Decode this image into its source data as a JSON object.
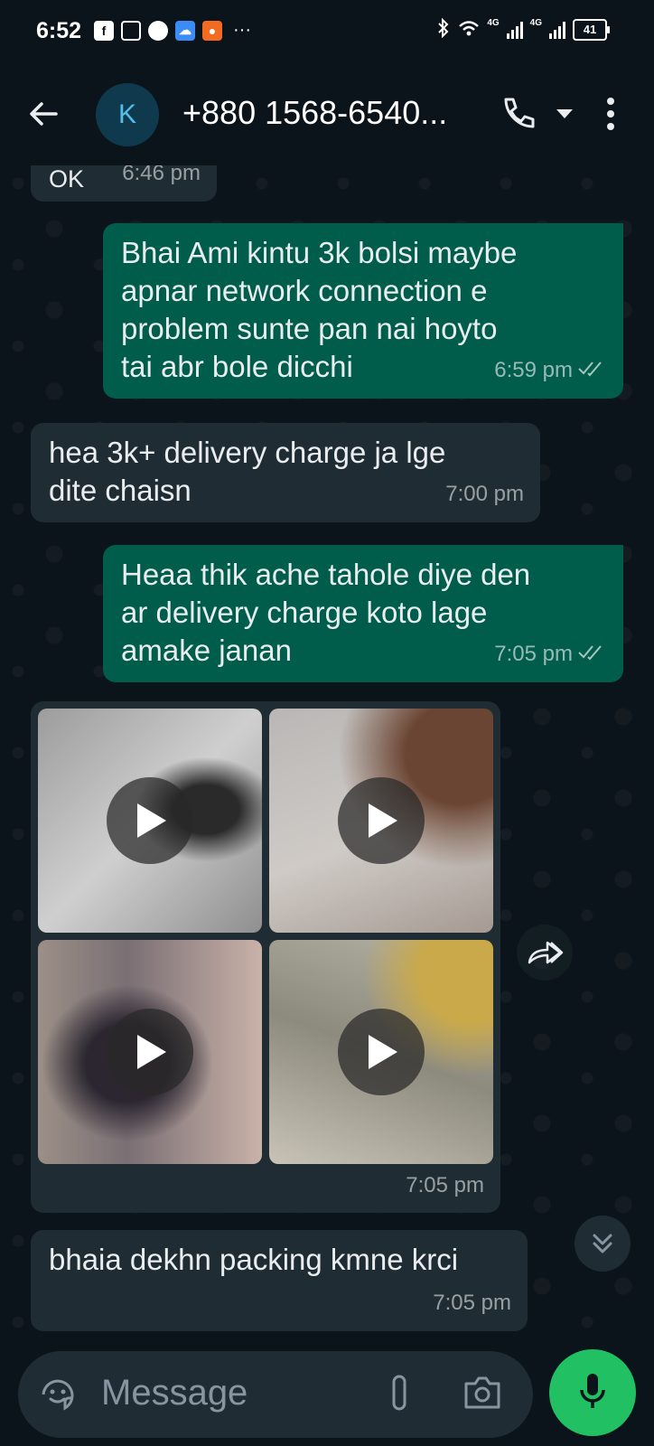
{
  "status_bar": {
    "time": "6:52",
    "battery": "41",
    "network_1": "4G",
    "network_2": "4G"
  },
  "header": {
    "avatar_letter": "K",
    "contact_name": "+880 1568-6540..."
  },
  "messages": [
    {
      "direction": "in",
      "text": "OK",
      "time": "6:46 pm"
    },
    {
      "direction": "out",
      "text": "Bhai Ami kintu 3k bolsi maybe\napnar network connection e\nproblem sunte pan nai hoyto\ntai abr bole dicchi",
      "time": "6:59 pm",
      "status": "read"
    },
    {
      "direction": "in",
      "text": "hea 3k+ delivery charge ja lge\ndite chaisn",
      "time": "7:00 pm"
    },
    {
      "direction": "out",
      "text": "Heaa thik ache tahole diye den\nar delivery charge koto lage\namake janan",
      "time": "7:05 pm",
      "status": "read"
    },
    {
      "direction": "in",
      "type": "video_album",
      "video_count": 4,
      "time": "7:05 pm"
    },
    {
      "direction": "in",
      "text": "bhaia dekhn packing kmne krci",
      "time": "7:05 pm"
    }
  ],
  "composer": {
    "placeholder": "Message"
  },
  "colors": {
    "background": "#0b141a",
    "incoming_bubble": "#202c33",
    "outgoing_bubble": "#005c4b",
    "accent_green": "#21c063",
    "avatar_bg": "#0f3a4e"
  },
  "icons": [
    "back-arrow-icon",
    "phone-icon",
    "dropdown-caret-icon",
    "more-vert-icon",
    "play-icon",
    "forward-icon",
    "scroll-down-icon",
    "sticker-icon",
    "attach-icon",
    "camera-icon",
    "mic-icon",
    "read-ticks-icon"
  ]
}
